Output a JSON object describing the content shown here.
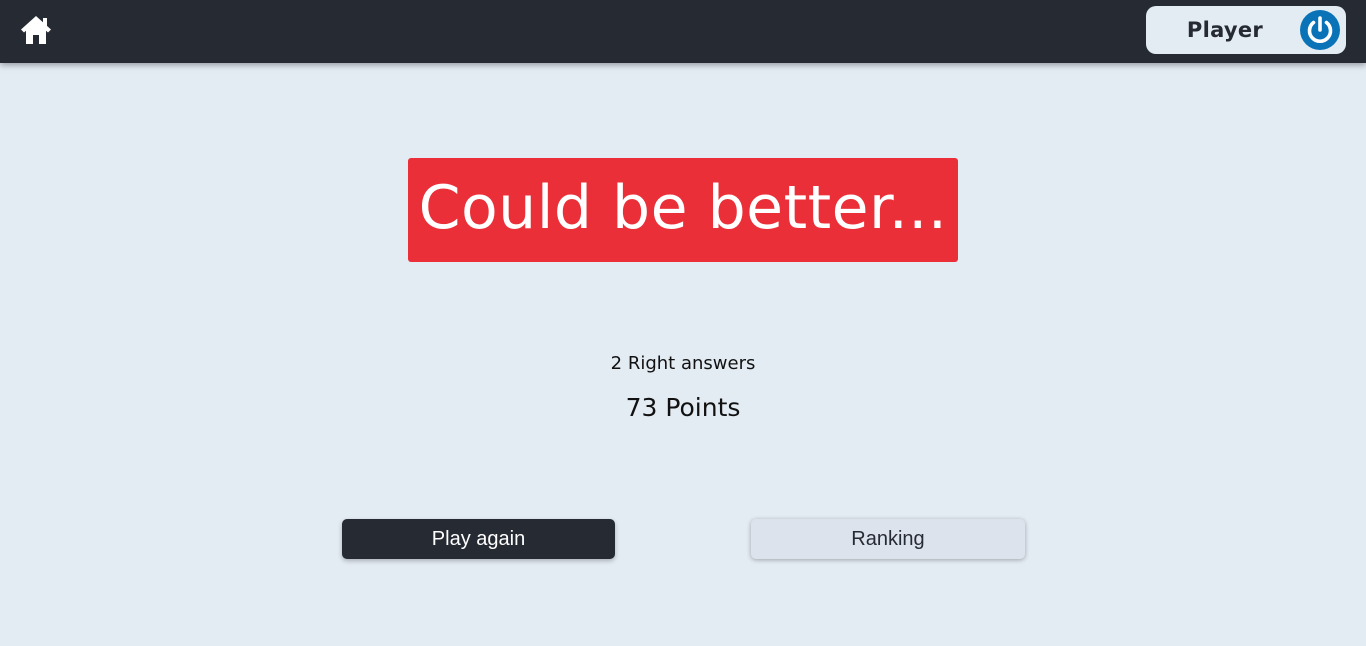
{
  "header": {
    "home_icon": "home-icon",
    "player_name": "Player",
    "logout_icon": "power-icon",
    "colors": {
      "bar": "#262a33",
      "chip": "#e3ebf3",
      "accent": "#0a73b8"
    }
  },
  "result": {
    "title": "Could be better...",
    "banner_color": "#eb2f38",
    "answers_text": "2 Right answers",
    "points_text": "73 Points"
  },
  "actions": {
    "play_again_label": "Play again",
    "ranking_label": "Ranking"
  }
}
